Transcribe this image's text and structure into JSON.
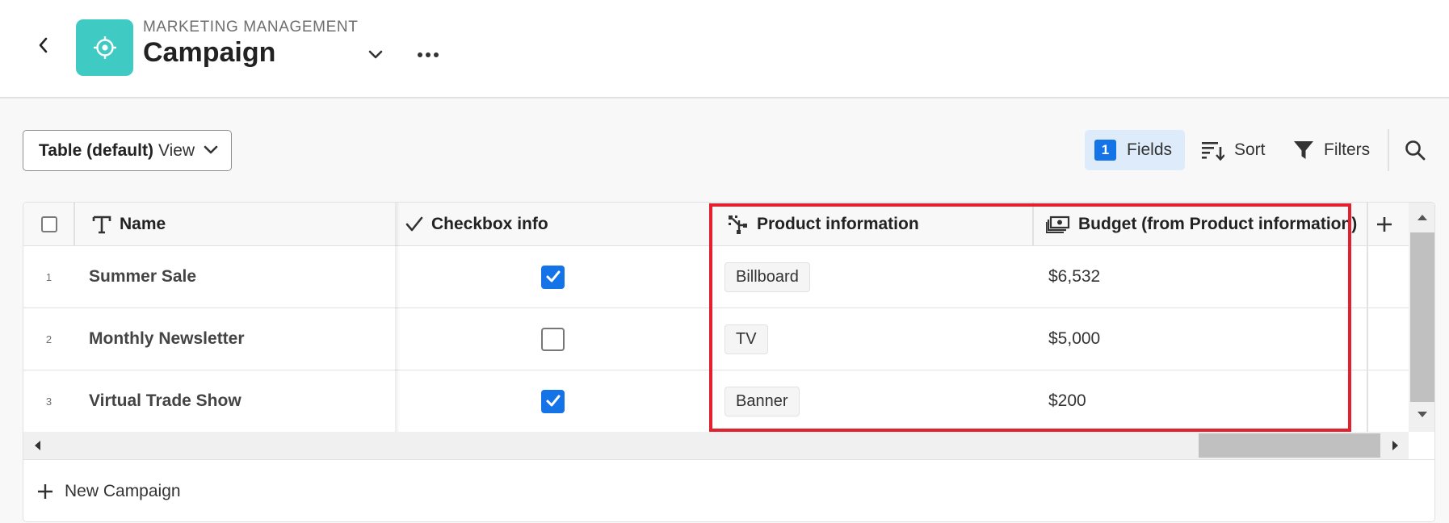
{
  "header": {
    "subtitle": "MARKETING MANAGEMENT",
    "title": "Campaign"
  },
  "toolbar": {
    "view_name": "Table (default)",
    "view_suffix": "View",
    "fields_count": "1",
    "fields_label": "Fields",
    "sort_label": "Sort",
    "filters_label": "Filters"
  },
  "table": {
    "columns": [
      {
        "label": "Name",
        "icon": "text-type-icon"
      },
      {
        "label": "Checkbox info",
        "icon": "checkmark-icon"
      },
      {
        "label": "Product information",
        "icon": "linked-record-icon"
      },
      {
        "label": "Budget (from Product information)",
        "icon": "money-icon"
      }
    ],
    "rows": [
      {
        "num": "1",
        "name": "Summer Sale",
        "checked": true,
        "product": "Billboard",
        "budget": "$6,532"
      },
      {
        "num": "2",
        "name": "Monthly Newsletter",
        "checked": false,
        "product": "TV",
        "budget": "$5,000"
      },
      {
        "num": "3",
        "name": "Virtual Trade Show",
        "checked": true,
        "product": "Banner",
        "budget": "$200"
      }
    ],
    "new_row_label": "New Campaign"
  },
  "colors": {
    "accent": "#1473e6",
    "app_icon": "#3fcbc3",
    "highlight": "#e3202e"
  }
}
